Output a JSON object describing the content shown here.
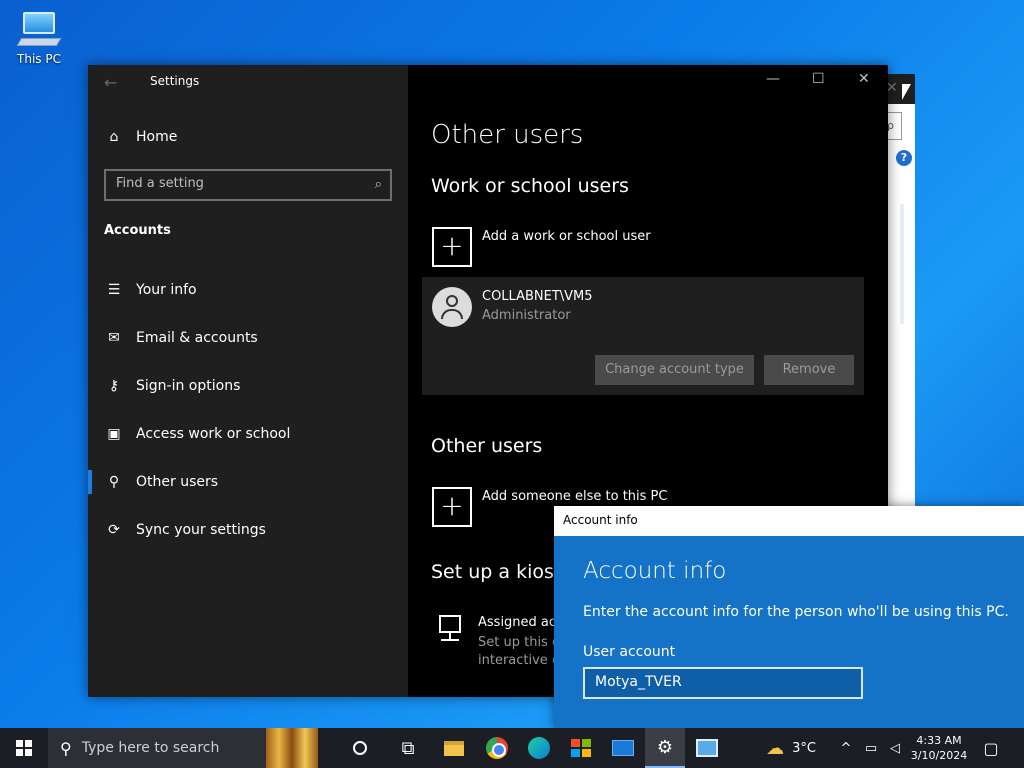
{
  "desktop": {
    "icon_label": "This PC"
  },
  "settings": {
    "title": "Settings",
    "home": "Home",
    "search_placeholder": "Find a setting",
    "section": "Accounts",
    "nav": [
      {
        "label": "Your info",
        "icon": "person-card-icon"
      },
      {
        "label": "Email & accounts",
        "icon": "mail-icon"
      },
      {
        "label": "Sign-in options",
        "icon": "key-icon"
      },
      {
        "label": "Access work or school",
        "icon": "briefcase-icon"
      },
      {
        "label": "Other users",
        "icon": "person-add-icon",
        "selected": true
      },
      {
        "label": "Sync your settings",
        "icon": "sync-icon"
      }
    ],
    "page_title": "Other users",
    "work_heading": "Work or school users",
    "add_work_label": "Add a work or school user",
    "user": {
      "name": "COLLABNET\\VM5",
      "role": "Administrator"
    },
    "change_type_btn": "Change account type",
    "remove_btn": "Remove",
    "other_heading": "Other users",
    "add_other_label": "Add someone else to this PC",
    "kiosk_heading": "Set up a kiosk",
    "kiosk_title": "Assigned acc",
    "kiosk_desc1": "Set up this d",
    "kiosk_desc2": "interactive d"
  },
  "dialog": {
    "title": "Account info",
    "heading": "Account info",
    "prompt": "Enter the account info for the person who'll be using this PC.",
    "field_label": "User account",
    "field_value": "Motya_TVER"
  },
  "taskbar": {
    "search_placeholder": "Type here to search",
    "weather": "3°C",
    "time": "4:33 AM",
    "date": "3/10/2024"
  },
  "colors": {
    "accent": "#1a7fe0",
    "dialog_bg": "#1473c7"
  }
}
